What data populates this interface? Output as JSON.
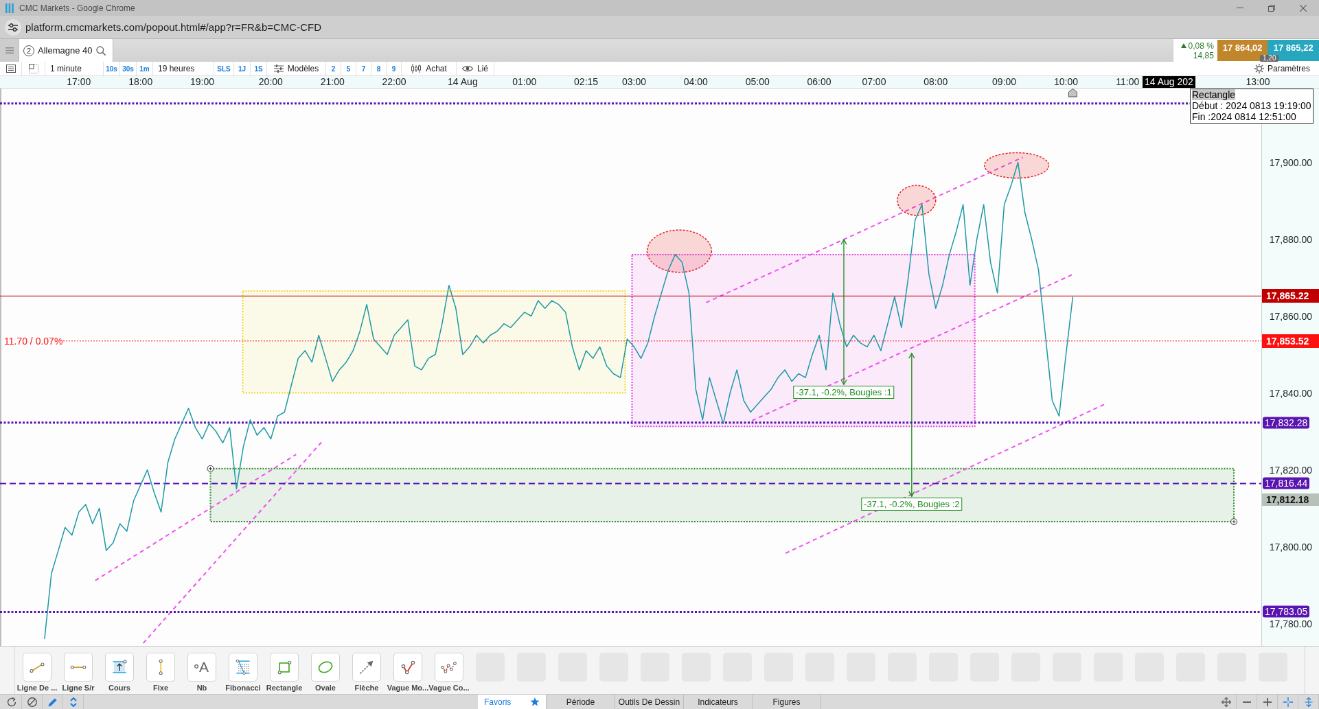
{
  "window": {
    "title": "CMC Markets - Google Chrome"
  },
  "address_bar": {
    "url": "platform.cmcmarkets.com/popout.html#/app?r=FR&b=CMC-CFD"
  },
  "instrument_tab": {
    "number": "2",
    "name": "Allemagne 40"
  },
  "quote": {
    "rising": true,
    "change_percent": "0,08 %",
    "change_points": "14,85",
    "sell": "17 864,02",
    "buy": "17 865,22",
    "spread": "1,20"
  },
  "toolbar": {
    "interval": "1 minute",
    "interval_shortcuts": [
      "10s",
      "30s",
      "1m"
    ],
    "period": "19 heures",
    "period_shortcuts": [
      "SLS",
      "1J",
      "1S"
    ],
    "templates": "Modèles",
    "template_shortcuts": [
      "2",
      "5",
      "7",
      "8",
      "9"
    ],
    "order": "Achat",
    "link": "Lié",
    "settings": "Paramètres"
  },
  "chart": {
    "crosshair_date": "14 Aug 202",
    "crosshair_price": "17,812.18",
    "tooltip": {
      "title": "Rectangle",
      "lines": [
        "Début : 2024 0813 19:19:00",
        "Fin :2024 0814 12:51:00"
      ]
    },
    "chart_data": {
      "type": "line",
      "ylim": [
        17774.2,
        17919.2
      ],
      "categories": [
        null,
        null,
        null,
        null,
        null,
        null,
        null,
        null,
        null,
        null,
        null,
        "17:00",
        null,
        null,
        null,
        null,
        null,
        null,
        null,
        null,
        "18:00",
        null,
        null,
        null,
        null,
        null,
        null,
        null,
        null,
        "19:00",
        null,
        null,
        null,
        null,
        null,
        null,
        null,
        null,
        null,
        "20:00",
        null,
        null,
        null,
        null,
        null,
        null,
        null,
        null,
        "21:00",
        null,
        null,
        null,
        null,
        null,
        null,
        null,
        null,
        "22:00",
        null,
        null,
        null,
        null,
        null,
        null,
        null,
        null,
        null,
        "14 Aug",
        null,
        null,
        null,
        null,
        null,
        null,
        null,
        null,
        "01:00",
        null,
        null,
        null,
        null,
        null,
        null,
        null,
        null,
        "02:15",
        null,
        null,
        null,
        null,
        null,
        null,
        "03:00",
        null,
        null,
        null,
        null,
        null,
        null,
        null,
        null,
        "04:00",
        null,
        null,
        null,
        null,
        null,
        null,
        null,
        null,
        "05:00",
        null,
        null,
        null,
        null,
        null,
        null,
        null,
        null,
        "06:00",
        null,
        null,
        null,
        null,
        null,
        null,
        null,
        "07:00",
        null,
        null,
        null,
        null,
        null,
        null,
        null,
        null,
        "08:00",
        null,
        null,
        null,
        null,
        null,
        null,
        null,
        null,
        null,
        "09:00",
        null,
        null,
        null,
        null,
        null,
        null,
        null,
        null,
        "10:00",
        null,
        null,
        null,
        null,
        null,
        null,
        null,
        null,
        "11:00",
        null,
        null,
        null,
        null,
        null,
        null,
        null,
        null,
        null,
        null,
        null,
        null,
        null,
        null,
        null,
        null,
        null,
        null,
        "13:00"
      ],
      "yticks": [
        {
          "value": 17900,
          "label": "17,900.00"
        },
        {
          "value": 17880,
          "label": "17,880.00"
        },
        {
          "value": 17860,
          "label": "17,860.00"
        },
        {
          "value": 17840,
          "label": "17,840.00"
        },
        {
          "value": 17820,
          "label": "17,820.00"
        },
        {
          "value": 17800,
          "label": "17,800.00"
        },
        {
          "value": 17780,
          "label": "17,780.00"
        }
      ],
      "series": [
        {
          "color": "#1d9aa5",
          "values": [
            null,
            null,
            null,
            null,
            null,
            null,
            17776,
            17793,
            17799,
            17805,
            17803,
            17809,
            17811,
            17806,
            17810,
            17799,
            17801,
            17806,
            17804,
            17812,
            17816,
            17820,
            17814,
            17809,
            17822,
            17828,
            17832,
            17836,
            17831,
            17828,
            17832,
            17830,
            17827,
            17831,
            17815,
            17826,
            17833,
            17829,
            17831,
            17828,
            17834,
            17835,
            17842,
            17849,
            17851,
            17848,
            17855,
            17849,
            17843,
            17846,
            17848,
            17851,
            17856,
            17863,
            17854,
            17852,
            17850,
            17855,
            17857,
            17859,
            17847,
            17846,
            17849,
            17850,
            17858,
            17868,
            17862,
            17850,
            17852,
            17855,
            17853,
            17855,
            17856,
            17858,
            17857,
            17859,
            17861,
            17860,
            17864,
            17862,
            17864,
            17863,
            17861,
            17852,
            17846,
            17851,
            17849,
            17852,
            17847,
            17845,
            17844,
            17854,
            17852,
            17849,
            17853,
            17860,
            17866,
            17872,
            17876,
            17874,
            17866,
            17841,
            17833,
            17844,
            17838,
            17832,
            17840,
            17846,
            17838,
            17835,
            17837,
            17839,
            17841,
            17844,
            17846,
            17843,
            17845,
            17844,
            17850,
            17855,
            17846,
            17866,
            17858,
            17852,
            17855,
            17853,
            17852,
            17855,
            17851,
            17858,
            17865,
            17857,
            17870,
            17885,
            17889,
            17871,
            17862,
            17868,
            17876,
            17882,
            17889,
            17868,
            17880,
            17889,
            17874,
            17866,
            17889,
            17894,
            17900,
            17887,
            17880,
            17872,
            17855,
            17838,
            17834,
            17850,
            17865,
            null,
            null,
            null,
            null,
            null,
            null,
            null,
            null,
            null,
            null,
            null,
            null,
            null,
            null,
            null,
            null,
            null,
            null,
            null,
            null,
            null,
            null,
            null,
            null,
            null,
            null,
            null
          ]
        }
      ],
      "ref_lines": [
        {
          "axis": "y",
          "value": 17915.3
        },
        {
          "axis": "y",
          "value": 17865.22,
          "label": "17,865.22"
        },
        {
          "axis": "y",
          "value": 17853.52,
          "label": "17,853.52"
        },
        {
          "axis": "y",
          "value": 17832.28,
          "label": "17,832.28"
        },
        {
          "axis": "y",
          "value": 17816.44,
          "label": "17,816.44"
        },
        {
          "axis": "y",
          "value": 17783.05,
          "label": "17,783.05"
        }
      ],
      "annotations": [
        "11.70 / 0.07%",
        "-37.1, -0.2%, Bougies :1",
        "-37.1, -0.2%, Bougies :2"
      ]
    }
  },
  "drawing_tools": [
    {
      "label": "Ligne De ...",
      "kind": "trend_line"
    },
    {
      "label": "Ligne S/r",
      "kind": "horizontal_line"
    },
    {
      "label": "Cours",
      "kind": "price_range"
    },
    {
      "label": "Fixe",
      "kind": "vertical_line"
    },
    {
      "label": "Nb",
      "kind": "text",
      "glyph": "A"
    },
    {
      "label": "Fibonacci",
      "kind": "fibonacci"
    },
    {
      "label": "Rectangle",
      "kind": "rectangle"
    },
    {
      "label": "Ovale",
      "kind": "ellipse"
    },
    {
      "label": "Flèche",
      "kind": "arrow"
    },
    {
      "label": "Vague Mo...",
      "kind": "impulse_wave"
    },
    {
      "label": "Vague Co...",
      "kind": "corrective_wave"
    }
  ],
  "bottom_bar": {
    "tabs": [
      {
        "label": "Favoris",
        "selected": true,
        "starred": true
      },
      {
        "label": "Période",
        "selected": false,
        "starred": false
      },
      {
        "label": "Outils De Dessin",
        "selected": false,
        "starred": false
      },
      {
        "label": "Indicateurs",
        "selected": false,
        "starred": false
      },
      {
        "label": "Figures",
        "selected": false,
        "starred": false
      }
    ]
  }
}
